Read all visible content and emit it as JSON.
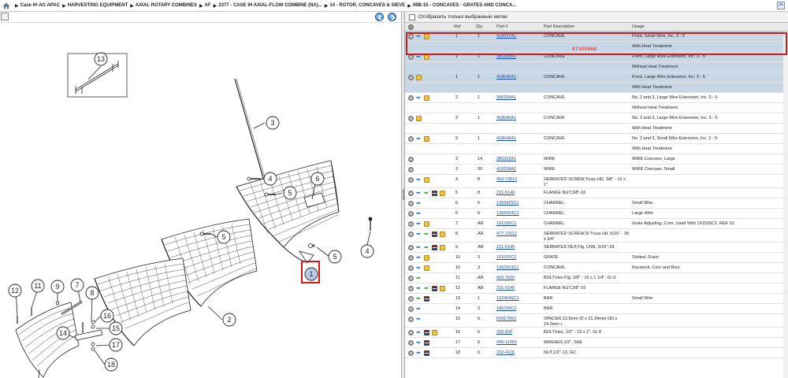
{
  "breadcrumb": {
    "items": [
      "Case IH AG APAC",
      "HARVESTING EQUIPMENT",
      "AXIAL ROTARY COMBINES",
      "AF",
      "2377 - CASE IH AXIAL-FLOW COMBINE (NA)...",
      "14 - ROTOR, CONCAVES & SIEVE",
      "09B-15 - CONCAVES - GRATES AND CONCA..."
    ],
    "separator": "▶"
  },
  "icons": {
    "home": "home-icon",
    "expand": "expand-icon",
    "prev": "arrow-left-circle-icon",
    "next": "arrow-right-circle-icon",
    "settings": "gear-icon",
    "details": "arrow-icon",
    "where_used": "green-arrow-icon",
    "notes": "book-icon",
    "cart": "box-icon"
  },
  "filter": {
    "label": "Отобразить только выбранные метки"
  },
  "table": {
    "headers": [
      "Ref",
      "Qty",
      "Part #",
      "Part Description",
      "Usage"
    ],
    "rows": [
      {
        "ref": "1",
        "qty": "1",
        "part": "418647A1",
        "desc": "CONCAVE",
        "usage": "Front, Small Wire, Inc. 3 - 5",
        "icons": [
          "gear",
          "arrow",
          "box"
        ],
        "hl": true
      },
      {
        "ref": "",
        "qty": "",
        "part": "",
        "desc": "",
        "usage": "With Heat Treatment",
        "icons": [],
        "hl": true,
        "sub": true
      },
      {
        "ref": "1",
        "qty": "1",
        "part": "386188A1",
        "desc": "CONCAVE",
        "usage": "Front, Large Wire Extension, Inc. 3 - 5",
        "icons": [
          "gear",
          "arrow",
          "box"
        ],
        "hl": true
      },
      {
        "ref": "",
        "qty": "",
        "part": "",
        "desc": "",
        "usage": "Without Heat Treatment",
        "icons": [],
        "hl": true,
        "sub": true
      },
      {
        "ref": "1",
        "qty": "1",
        "part": "418645A1",
        "desc": "CONCAVE",
        "usage": "Front, Large Wire Extension, Inc. 3 - 5",
        "icons": [
          "gear",
          "box"
        ],
        "hl": true
      },
      {
        "ref": "",
        "qty": "",
        "part": "",
        "desc": "",
        "usage": "With Heat Treatment",
        "icons": [],
        "hl": true,
        "sub": true
      },
      {
        "ref": "2",
        "qty": "1",
        "part": "386189A1",
        "desc": "CONCAVE",
        "usage": "No. 2 and 3, Large Wire Extension, Inc. 3 - 5",
        "icons": [
          "gear",
          "arrow",
          "box"
        ]
      },
      {
        "ref": "",
        "qty": "",
        "part": "",
        "desc": "",
        "usage": "Without Heat Treatment",
        "icons": [],
        "sub": true
      },
      {
        "ref": "2",
        "qty": "1",
        "part": "418646A1",
        "desc": "CONCAVE",
        "usage": "No. 2 and 3, Large Wire Extension, Inc. 3 - 5",
        "icons": [
          "gear",
          "box"
        ]
      },
      {
        "ref": "",
        "qty": "",
        "part": "",
        "desc": "",
        "usage": "With Heat Treatment",
        "icons": [],
        "sub": true
      },
      {
        "ref": "2",
        "qty": "1",
        "part": "418648A1",
        "desc": "CONCAVE",
        "usage": "No. 2 and 3, Small Wire Extension, Inc. 3 - 5",
        "icons": [
          "gear",
          "arrow",
          "box"
        ]
      },
      {
        "ref": "",
        "qty": "",
        "part": "",
        "desc": "",
        "usage": "With Heat Treatment",
        "icons": [],
        "sub": true
      },
      {
        "ref": "3",
        "qty": "14",
        "part": "386352A1",
        "desc": "WIRE",
        "usage": "WIRE Concave, Large",
        "icons": [
          "gear"
        ]
      },
      {
        "ref": "3",
        "qty": "30",
        "part": "418158A1",
        "desc": "WIRE",
        "usage": "WIRE Concave, Small",
        "icons": [
          "gear"
        ]
      },
      {
        "ref": "4",
        "qty": "8",
        "part": "459-73816",
        "desc": "SERRATED SCREW,Truss HD, 3/8\" - 16 x 1\"",
        "usage": "",
        "icons": [
          "gear",
          "arrow",
          "box"
        ],
        "tall": true
      },
      {
        "ref": "5",
        "qty": "8",
        "part": "231-5146",
        "desc": "FLANGE NUT,3/8\"-16",
        "usage": "",
        "icons": [
          "gear",
          "arrow",
          "green",
          "book",
          "box"
        ]
      },
      {
        "ref": "6",
        "qty": "6",
        "part": "1359425C1",
        "desc": "CHANNEL",
        "usage": "Small Wire",
        "icons": [
          "gear",
          "arrow"
        ]
      },
      {
        "ref": "6",
        "qty": "6",
        "part": "1359424C1",
        "desc": "CHANNEL",
        "usage": "Large Wire",
        "icons": [
          "gear",
          "arrow"
        ]
      },
      {
        "ref": "7",
        "qty": "AR",
        "part": "191536C1",
        "desc": "CHANNEL",
        "usage": "Grate Adjusting, Corn, Used With 191535C2, REF 10",
        "icons": [
          "gear",
          "arrow",
          "box"
        ]
      },
      {
        "ref": "8",
        "qty": "AR",
        "part": "477-73112",
        "desc": "SERRATED SCREW,Sl Truss Hd, 5/16\" - 18 x 3/4\"",
        "usage": "",
        "icons": [
          "gear",
          "arrow",
          "green",
          "book",
          "box"
        ],
        "tall": true
      },
      {
        "ref": "9",
        "qty": "AR",
        "part": "231-5145",
        "desc": "SERRATED NUT,Flg, USR, 5/16\"-18",
        "usage": "",
        "icons": [
          "gear",
          "arrow",
          "green",
          "book",
          "box"
        ]
      },
      {
        "ref": "10",
        "qty": "3",
        "part": "191535C2",
        "desc": "GRATE",
        "usage": "Slotted, Grain",
        "icons": [
          "gear",
          "arrow",
          "box"
        ]
      },
      {
        "ref": "10",
        "qty": "3",
        "part": "1362563C1",
        "desc": "CONCAVE",
        "usage": "Keystock, Corn and Rice",
        "icons": [
          "gear",
          "arrow",
          "box"
        ]
      },
      {
        "ref": "11",
        "qty": "AR",
        "part": "419-7626",
        "desc": "BOLT,Hex Flg, 3/8\" - 16 x 1 1/4\", Gr 8",
        "usage": "",
        "icons": [
          "gear",
          "green"
        ]
      },
      {
        "ref": "12",
        "qty": "AR",
        "part": "231-5146",
        "desc": "FLANGE NUT,3/8\"-16",
        "usage": "",
        "icons": [
          "gear",
          "arrow",
          "green",
          "book",
          "box"
        ]
      },
      {
        "ref": "13",
        "qty": "1",
        "part": "1324046C3",
        "desc": "BAR",
        "usage": "Small Wire",
        "icons": [
          "gear",
          "green",
          "book"
        ]
      },
      {
        "ref": "14",
        "qty": "3",
        "part": "186784C2",
        "desc": "BAR",
        "usage": "",
        "icons": [
          "gear",
          "arrow"
        ]
      },
      {
        "ref": "15",
        "qty": "6",
        "part": "609179R1",
        "desc": "SPACER,13.9mm ID x 21.34mm OD x 14.3mm L",
        "usage": "",
        "icons": [
          "gear",
          "arrow"
        ],
        "tall": true
      },
      {
        "ref": "16",
        "qty": "6",
        "part": "326-832",
        "desc": "BOLT,Hex, 1/2\" - 13 x 2\", Gr 8",
        "usage": "",
        "icons": [
          "gear",
          "arrow",
          "book",
          "box"
        ]
      },
      {
        "ref": "17",
        "qty": "6",
        "part": "495-11053",
        "desc": "WASHER,1/2\", SAE",
        "usage": "",
        "icons": [
          "gear",
          "arrow",
          "book"
        ]
      },
      {
        "ref": "18",
        "qty": "6",
        "part": "232-4118",
        "desc": "NUT,1/2\"-13, GC",
        "usage": "",
        "icons": [
          "gear",
          "arrow",
          "book"
        ]
      }
    ]
  },
  "annotation": {
    "text": "87300868"
  },
  "diagram": {
    "callouts": [
      "13",
      "3",
      "4",
      "6",
      "5",
      "5",
      "5",
      "4",
      "1",
      "2",
      "12",
      "11",
      "9",
      "7",
      "8",
      "16",
      "15",
      "14",
      "17",
      "18",
      "10"
    ]
  }
}
